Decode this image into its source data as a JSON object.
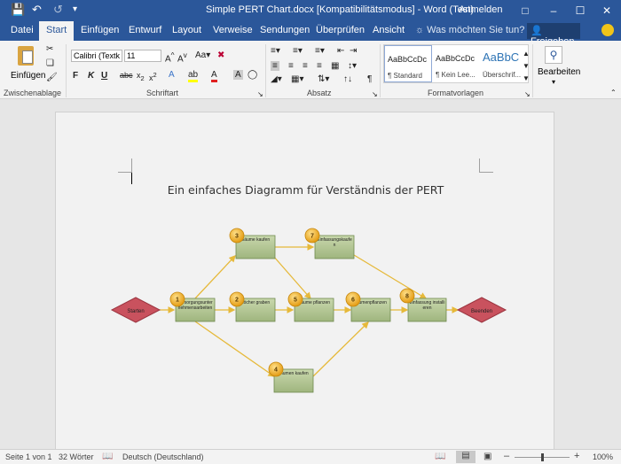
{
  "titlebar": {
    "title": "Simple PERT Chart.docx [Kompatibilitätsmodus]  -  Word (Test)",
    "signin": "Anmelden"
  },
  "tabs": [
    "Datei",
    "Start",
    "Einfügen",
    "Entwurf",
    "Layout",
    "Verweise",
    "Sendungen",
    "Überprüfen",
    "Ansicht"
  ],
  "tellme": "Was möchten Sie tun?",
  "share": "Freigeben",
  "ribbon": {
    "paste_label": "Einfügen",
    "font_name": "Calibri (Textk",
    "font_size": "11",
    "styles": [
      {
        "sample": "AaBbCcDc",
        "name": "¶ Standard"
      },
      {
        "sample": "AaBbCcDc",
        "name": "¶ Kein Lee..."
      },
      {
        "sample": "AaBbC",
        "name": "Überschrif..."
      }
    ],
    "search_label": "Bearbeiten",
    "groups": {
      "clipboard": "Zwischenablage",
      "font": "Schriftart",
      "paragraph": "Absatz",
      "styles": "Formatvorlagen"
    }
  },
  "document": {
    "title": "Ein einfaches Diagramm für Verständnis der PERT"
  },
  "diagram": {
    "start_label": "Starten",
    "end_label": "Beenden",
    "tasks": [
      {
        "num": "1",
        "label": "Versorgungsunternehmensarbeiten"
      },
      {
        "num": "2",
        "label": "Löcher graben"
      },
      {
        "num": "3",
        "label": "Bäume kaufen"
      },
      {
        "num": "4",
        "label": "Blumen kaufen"
      },
      {
        "num": "5",
        "label": "Bäume pflanzen"
      },
      {
        "num": "6",
        "label": "Blumenpflanzen"
      },
      {
        "num": "7",
        "label": "Einfassungskaufen"
      },
      {
        "num": "8",
        "label": "Einfassung installieren"
      }
    ],
    "colors": {
      "task_fill": "#b7c99a",
      "badge_fill": "#f2b630",
      "diamond_fill": "#c9525e",
      "connector": "#e6b93a"
    }
  },
  "statusbar": {
    "page": "Seite 1 von 1",
    "words": "32 Wörter",
    "language": "Deutsch (Deutschland)",
    "zoom": "100%"
  }
}
